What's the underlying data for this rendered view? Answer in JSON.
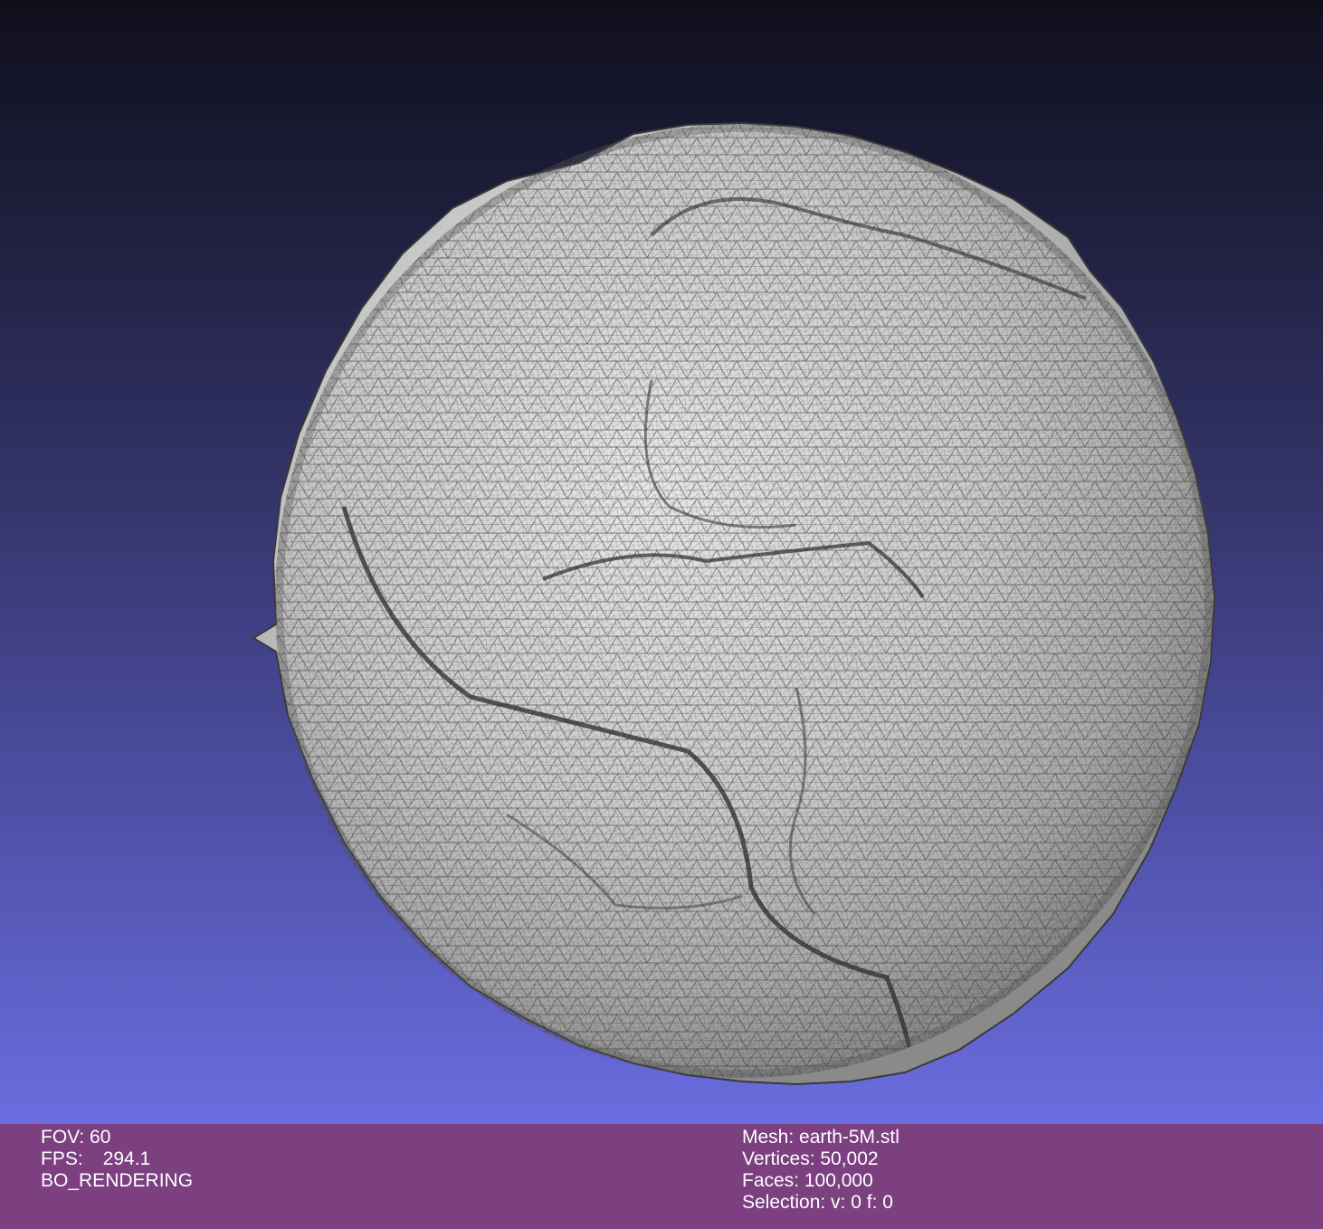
{
  "colors": {
    "background_top": "#0f0f1c",
    "background_bottom": "#6a6ddf",
    "info_bar": "#7c3f80",
    "mesh_fill": "#c8c8c8",
    "wireframe": "#2a2a2a",
    "info_text": "#ffffff"
  },
  "viewport": {
    "object": "earth mesh rendered with flat-lines wireframe"
  },
  "info_left": {
    "fov_label": "FOV: 60",
    "fps_label": "FPS:",
    "fps_value": "294.1",
    "render_mode": "BO_RENDERING"
  },
  "info_right": {
    "mesh": "Mesh: earth-5M.stl",
    "vertices": "Vertices: 50,002",
    "faces": "Faces: 100,000",
    "selection": "Selection: v: 0 f: 0"
  }
}
